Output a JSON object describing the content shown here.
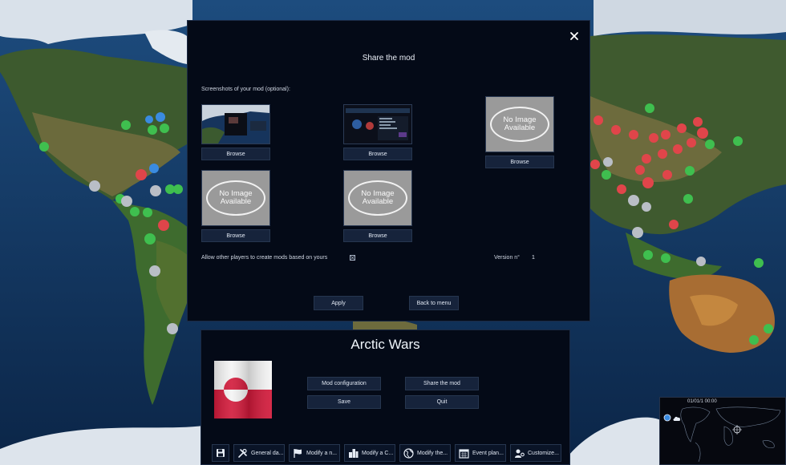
{
  "dialog": {
    "title": "Share the mod",
    "screenshots_label": "Screenshots of your mod (optional):",
    "no_image_line1": "No Image",
    "no_image_line2": "Available",
    "browse_label": "Browse",
    "allow_label": "Allow other players to create mods based on yours",
    "version_label": "Version n°",
    "version_value": "1",
    "apply_label": "Apply",
    "back_label": "Back to menu"
  },
  "mod_panel": {
    "title": "Arctic Wars",
    "mod_configuration_label": "Mod configuration",
    "share_label": "Share the mod",
    "save_label": "Save",
    "quit_label": "Quit"
  },
  "toolbar": {
    "items": [
      {
        "label": "General da..."
      },
      {
        "label": "Modify a n..."
      },
      {
        "label": "Modify a C..."
      },
      {
        "label": "Modify the..."
      },
      {
        "label": "Event plan..."
      },
      {
        "label": "Customize..."
      }
    ]
  },
  "minimap": {
    "date": "01/01/1 00:00"
  },
  "colors": {
    "ally": "#3fbf4f",
    "enemy": "#e0454a",
    "neutral": "#b9bec6",
    "friendly_blue": "#3a8be0"
  }
}
